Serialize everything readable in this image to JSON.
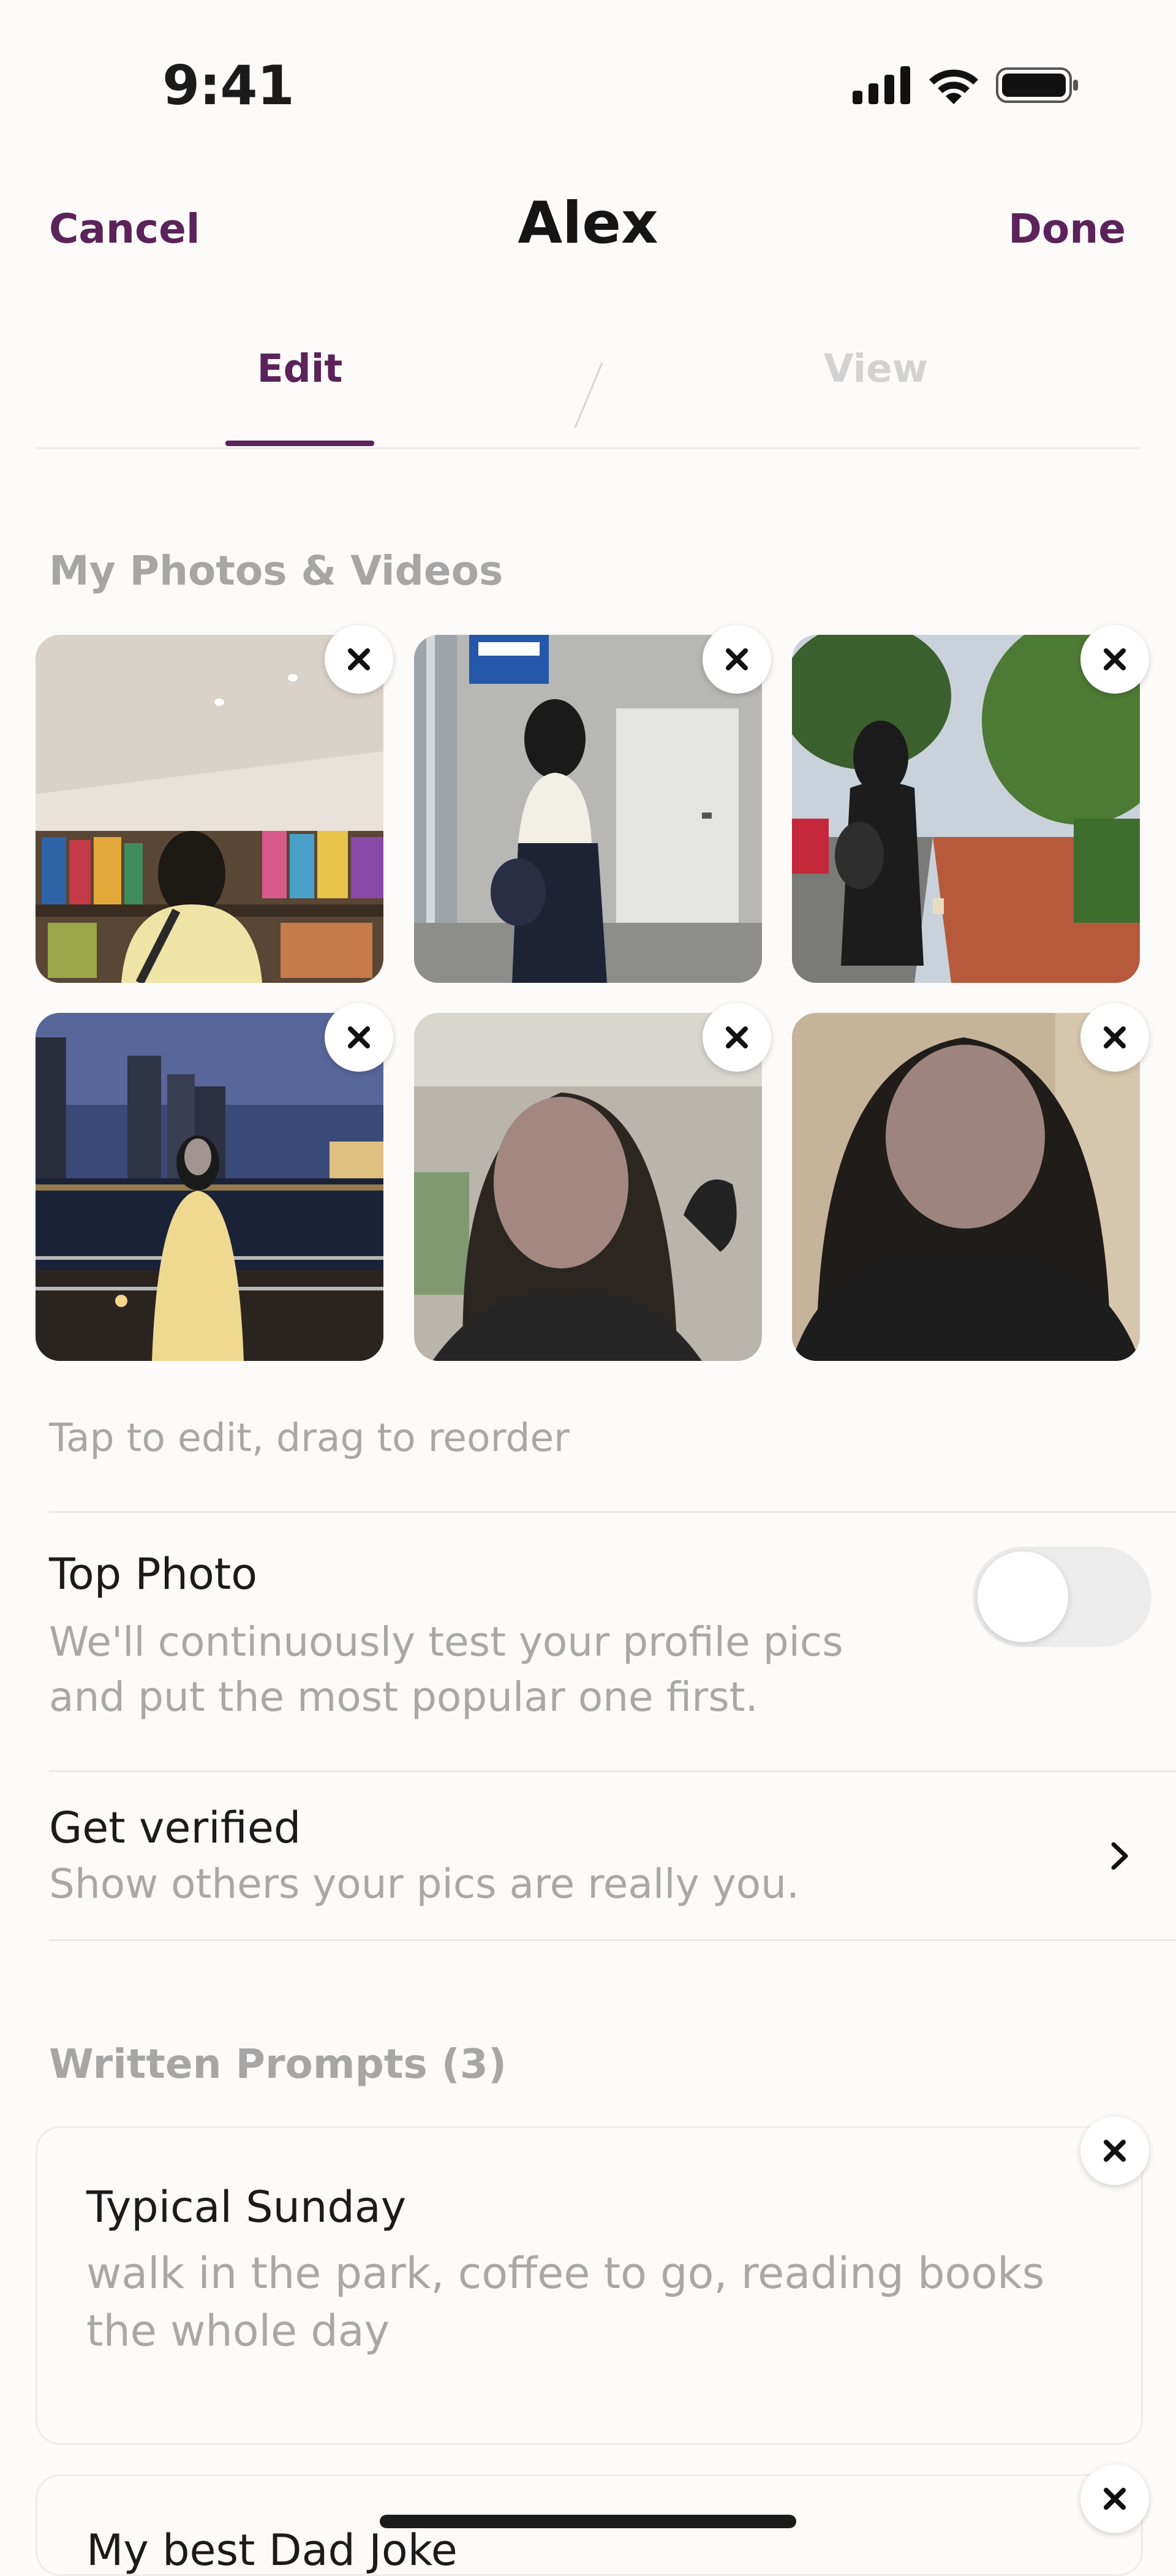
{
  "status_bar": {
    "time": "9:41"
  },
  "nav": {
    "cancel_label": "Cancel",
    "title": "Alex",
    "done_label": "Done"
  },
  "tabs": [
    {
      "label": "Edit",
      "active": true
    },
    {
      "label": "View",
      "active": false
    }
  ],
  "photos_section": {
    "title": "My Photos & Videos",
    "photos": [
      {
        "description": "woman in yellow top browsing a bookstore"
      },
      {
        "description": "woman in white blouse and dark skirt by a grey wall"
      },
      {
        "description": "woman in black dress walking on a red brick sidewalk"
      },
      {
        "description": "woman in yellow top at a city waterfront at night"
      },
      {
        "description": "selfie in a car, face blurred"
      },
      {
        "description": "selfie in dark top, face blurred"
      }
    ],
    "hint": "Tap to edit, drag to reorder"
  },
  "top_photo": {
    "title": "Top Photo",
    "description_line1": "We'll continuously test your profile pics",
    "description_line2": "and put the most popular one first.",
    "enabled": false
  },
  "get_verified": {
    "title": "Get verified",
    "description": "Show others your pics are really you."
  },
  "prompts_section": {
    "title": "Written Prompts (3)",
    "prompts": [
      {
        "question": "Typical Sunday",
        "answer_line1": "walk in the park, coffee to go, reading books",
        "answer_line2": "the whole day"
      },
      {
        "question": "My best Dad Joke",
        "answer_line1": "",
        "answer_line2": ""
      }
    ]
  },
  "colors": {
    "accent": "#5b2359",
    "background": "#fcfbfa",
    "muted_text": "#a8a8a8"
  }
}
